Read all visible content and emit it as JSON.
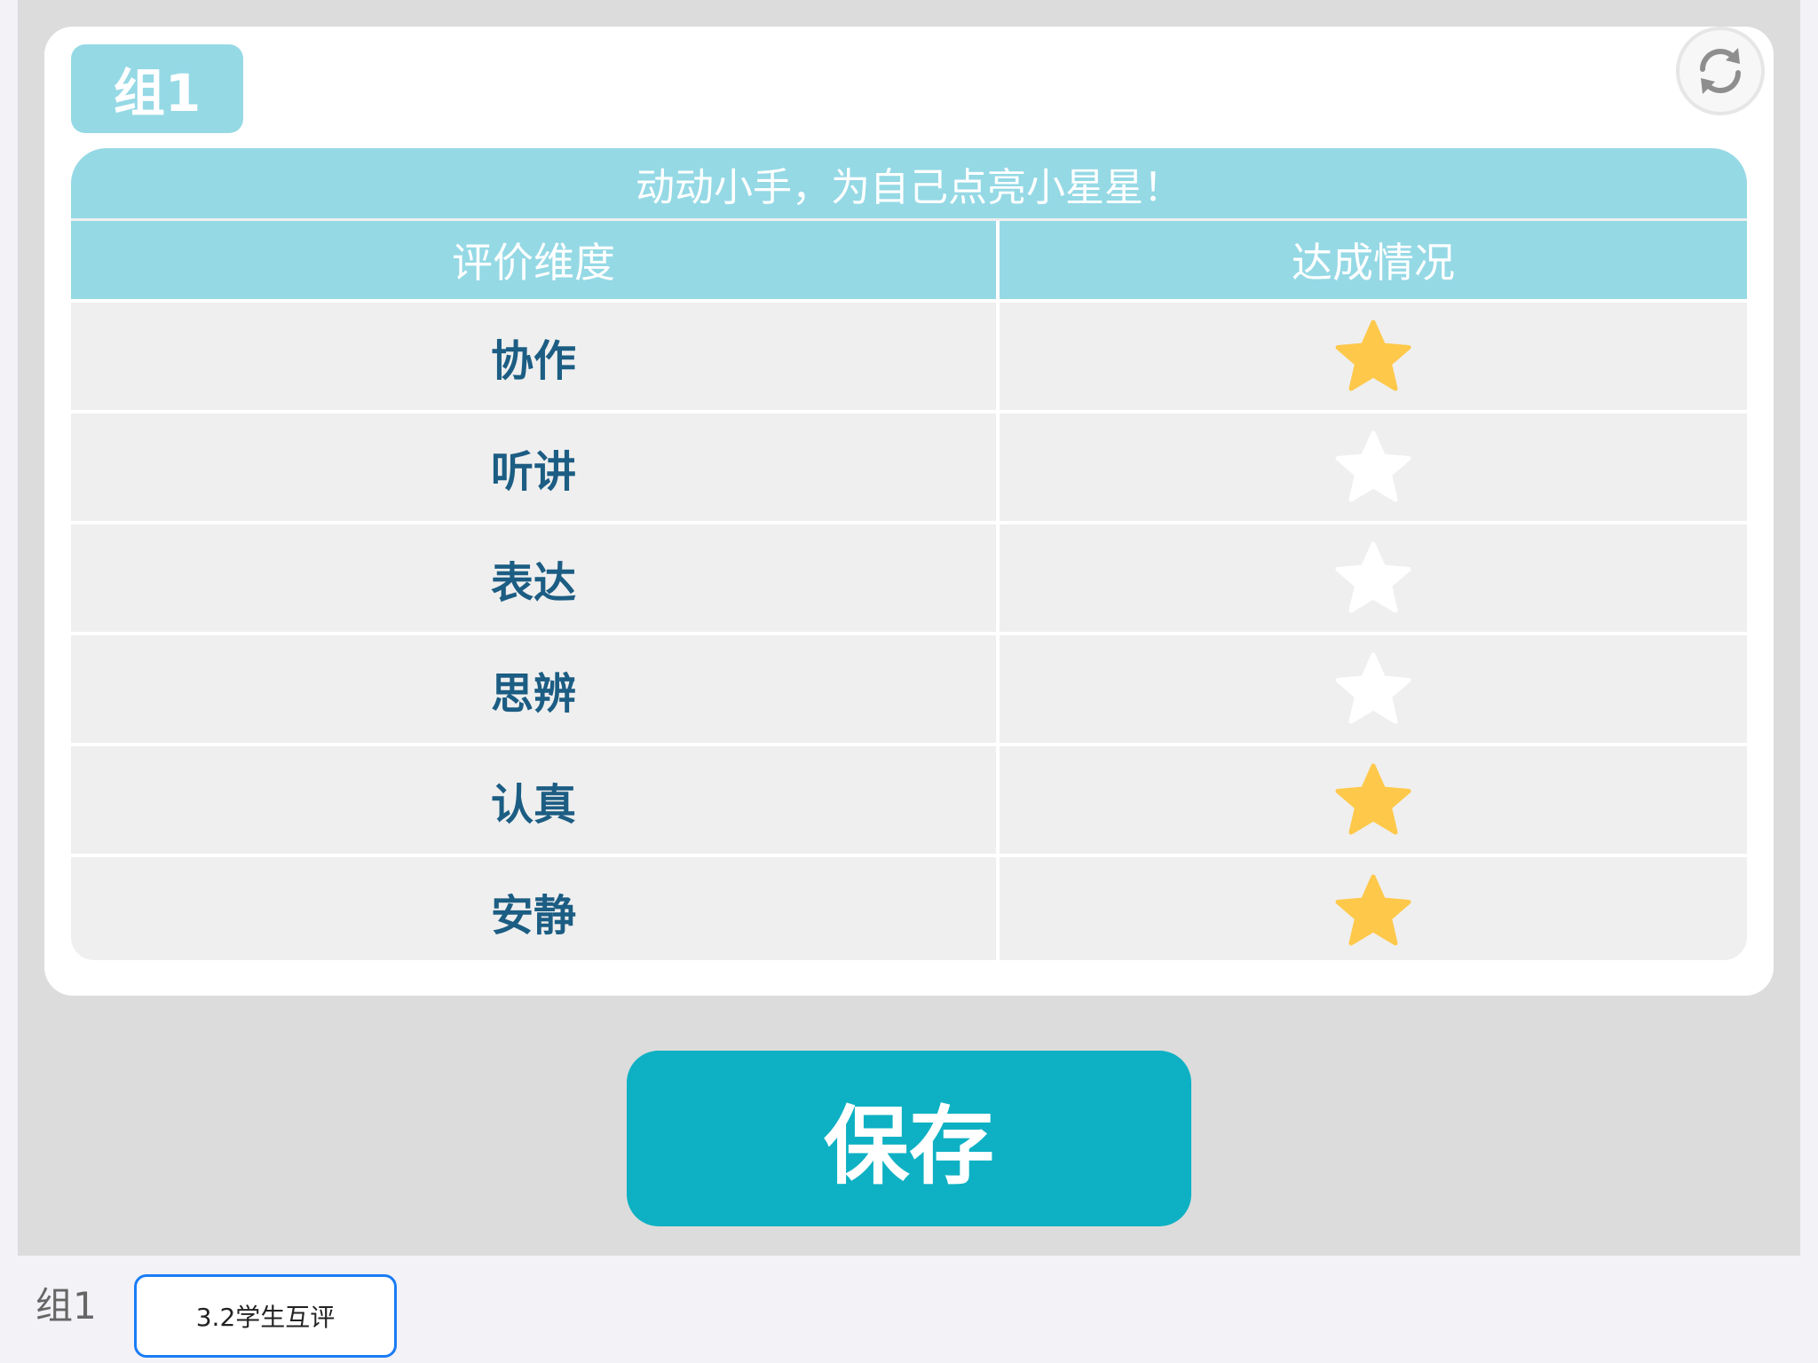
{
  "group": {
    "label": "组1"
  },
  "table": {
    "title": "动动小手，为自己点亮小星星！",
    "headers": {
      "dimension": "评价维度",
      "status": "达成情况"
    },
    "rows": [
      {
        "label": "协作",
        "lit": true
      },
      {
        "label": "听讲",
        "lit": false
      },
      {
        "label": "表达",
        "lit": false
      },
      {
        "label": "思辨",
        "lit": false
      },
      {
        "label": "认真",
        "lit": true
      },
      {
        "label": "安静",
        "lit": true
      }
    ]
  },
  "icons": {
    "star_lit": "star-icon-filled",
    "star_unlit": "star-icon-empty",
    "refresh": "refresh-icon"
  },
  "colors": {
    "accent": "#95d9e5",
    "save": "#0db1c3",
    "star_lit": "#fec84a",
    "star_unlit": "#ffffff",
    "label_text": "#1c5d83",
    "tab_border": "#1a7cf5"
  },
  "save_button": {
    "label": "保存"
  },
  "footer": {
    "group_label": "组1",
    "tab_label": "3.2学生互评"
  }
}
